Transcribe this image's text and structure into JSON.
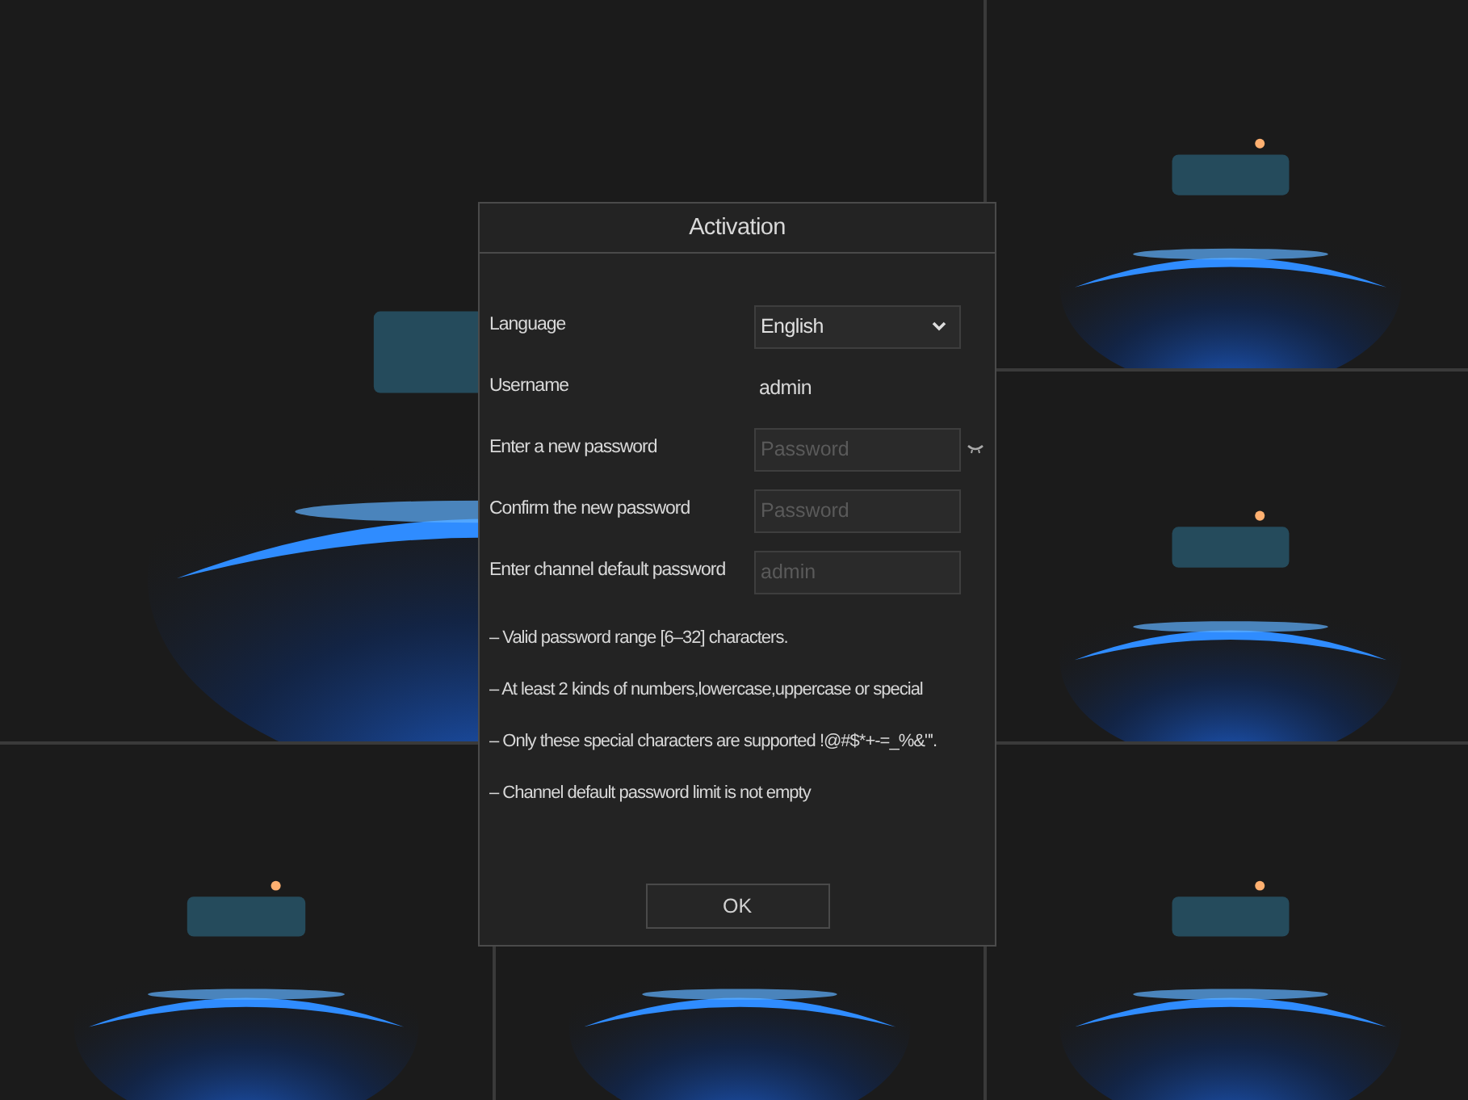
{
  "dialog": {
    "title": "Activation",
    "fields": [
      {
        "kind": "select",
        "label": "Language",
        "value": "English"
      },
      {
        "kind": "text",
        "label": "Username",
        "value": "admin"
      },
      {
        "kind": "password",
        "label": "Enter a new password",
        "placeholder": "Password",
        "reveal": false
      },
      {
        "kind": "password",
        "label": "Confirm the new password",
        "placeholder": "Password"
      },
      {
        "kind": "password",
        "label": "Enter channel default password",
        "placeholder": "admin"
      }
    ],
    "notes": [
      "– Valid password range [6–32] characters.",
      "– At least 2 kinds of numbers,lowercase,uppercase or special",
      "– Only these special characters are supported !@#$*+-=_%&\"'.",
      "– Channel default password limit is not empty"
    ],
    "buttons": [
      "OK"
    ]
  }
}
